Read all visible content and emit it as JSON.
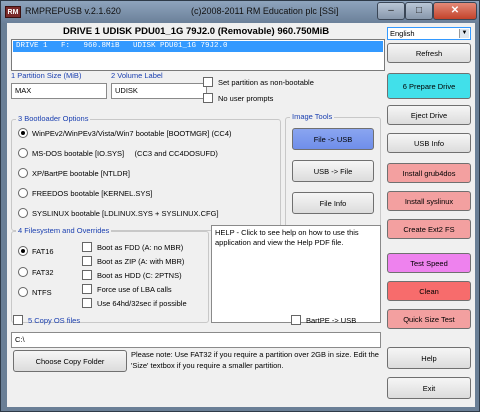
{
  "window": {
    "app_icon_text": "RM",
    "title_left": "RMPREPUSB v.2.1.620",
    "title_center": "(c)2008-2011 RM Education plc [SSi]",
    "min_glyph": "–",
    "max_glyph": "□",
    "close_glyph": "✕"
  },
  "drive": {
    "heading": "DRIVE 1   UDISK PDU01_1G 79J2.0   (Removable)   960.750MiB",
    "row": "DRIVE 1   F:   960.8MiB   UDISK PDU01_1G 79J2.0"
  },
  "language": {
    "selected": "English",
    "arrow": "▼"
  },
  "partition": {
    "size_label": "1 Partition Size (MiB)",
    "size_value": "MAX",
    "volume_label": "2 Volume Label",
    "volume_value": "UDISK",
    "non_bootable": "Set partition as non-bootable",
    "no_prompts": "No user prompts"
  },
  "bootloader": {
    "label": "3 Bootloader Options",
    "options": [
      {
        "label": "WinPEv2/WinPEv3/Vista/Win7 bootable [BOOTMGR] (CC4)",
        "selected": true
      },
      {
        "label": "MS-DOS bootable [IO.SYS]     (CC3 and CC4DOSUFD)",
        "selected": false
      },
      {
        "label": "XP/BartPE bootable [NTLDR]",
        "selected": false
      },
      {
        "label": "FREEDOS bootable [KERNEL.SYS]",
        "selected": false
      },
      {
        "label": "SYSLINUX bootable [LDLINUX.SYS + SYSLINUX.CFG]",
        "selected": false
      }
    ]
  },
  "image_tools": {
    "label": "Image Tools",
    "file_to_usb": "File -> USB",
    "usb_to_file": "USB -> File",
    "file_info": "File Info"
  },
  "filesystem": {
    "label": "4 Filesystem and Overrides",
    "options": [
      {
        "label": "FAT16",
        "selected": true
      },
      {
        "label": "FAT32",
        "selected": false
      },
      {
        "label": "NTFS",
        "selected": false
      }
    ],
    "overrides": [
      "Boot as FDD (A: no MBR)",
      "Boot as ZIP (A: with MBR)",
      "Boot as HDD (C: 2PTNS)",
      "Force use of LBA calls",
      "Use 64hd/32sec if possible"
    ]
  },
  "help_text": "HELP - Click to see help on how to use this application and view the Help PDF file.",
  "copy_os": {
    "label": "5 Copy OS files",
    "bartpe": "BartPE -> USB",
    "path": "C:\\",
    "choose_button": "Choose Copy Folder",
    "note": "Please note: Use FAT32 if you require a partition over 2GB in size. Edit the 'Size' textbox if you require a smaller partition."
  },
  "side_buttons": {
    "refresh": "Refresh",
    "prepare": "6 Prepare Drive",
    "eject": "Eject Drive",
    "usb_info": "USB Info",
    "grub4dos": "Install grub4dos",
    "syslinux": "Install syslinux",
    "ext2": "Create Ext2 FS",
    "test_speed": "Test Speed",
    "clean": "Clean",
    "quick_size": "Quick Size Test",
    "help": "Help",
    "exit": "Exit"
  },
  "colors": {
    "selection": "#3399ff",
    "prepare": "#41e0ea",
    "install": "#f3a0a0",
    "test_speed": "#ee82ee",
    "clean": "#f76c6c",
    "file_to_usb": "#7f98ee"
  }
}
